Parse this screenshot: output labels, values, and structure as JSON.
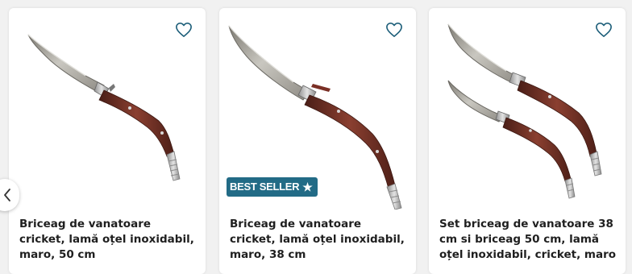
{
  "products": [
    {
      "title": "Briceag de vanatoare cricket, lamă oțel inoxidabil, maro, 50 cm",
      "badge": ""
    },
    {
      "title": "Briceag de vanatoare cricket, lamă oțel inoxidabil, maro, 38 cm",
      "badge": "BEST SELLER"
    },
    {
      "title": "Set briceag de vanatoare 38 cm si briceag 50 cm, lamă oțel inoxidabil, cricket, maro",
      "badge": ""
    }
  ],
  "icons": {
    "favorite": "heart-outline-icon",
    "badge_star": "star-icon",
    "carousel_prev": "chevron-left-icon"
  },
  "colors": {
    "heart": "#1e5f7a",
    "badge_bg": "#226b86",
    "handle_wood": "#6b2f25",
    "blade": "#9c9c96"
  }
}
